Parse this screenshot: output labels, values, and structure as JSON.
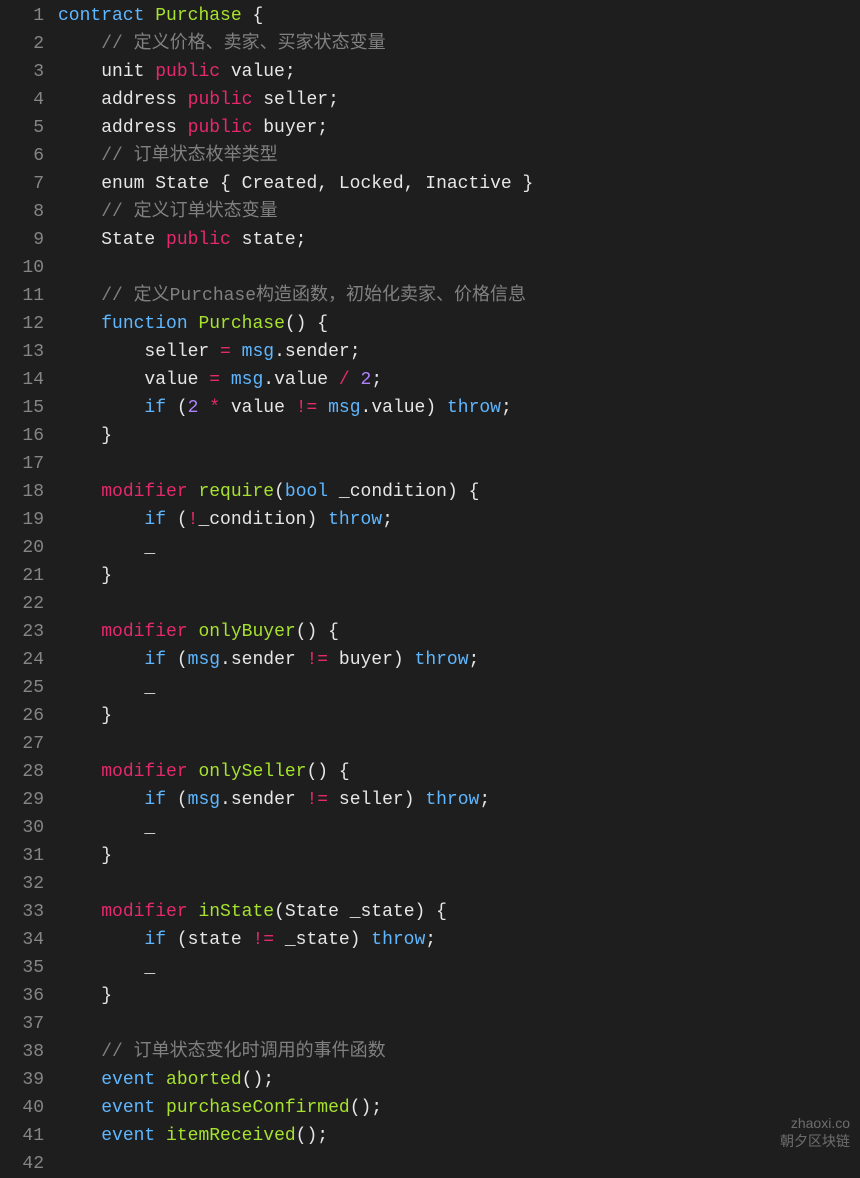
{
  "watermark": {
    "line1": "zhaoxi.co",
    "line2": "朝夕区块链"
  },
  "lines": [
    {
      "n": 1,
      "tokens": [
        [
          "kw",
          "contract"
        ],
        [
          "sp",
          " "
        ],
        [
          "type",
          "Purchase"
        ],
        [
          "sp",
          " "
        ],
        [
          "punc",
          "{"
        ]
      ]
    },
    {
      "n": 2,
      "tokens": [
        [
          "ind",
          "    "
        ],
        [
          "comm",
          "// 定义价格、卖家、买家状态变量"
        ]
      ]
    },
    {
      "n": 3,
      "tokens": [
        [
          "ind",
          "    "
        ],
        [
          "id",
          "unit "
        ],
        [
          "mod",
          "public"
        ],
        [
          "id",
          " value;"
        ]
      ]
    },
    {
      "n": 4,
      "tokens": [
        [
          "ind",
          "    "
        ],
        [
          "id",
          "address "
        ],
        [
          "mod",
          "public"
        ],
        [
          "id",
          " seller;"
        ]
      ]
    },
    {
      "n": 5,
      "tokens": [
        [
          "ind",
          "    "
        ],
        [
          "id",
          "address "
        ],
        [
          "mod",
          "public"
        ],
        [
          "id",
          " buyer;"
        ]
      ]
    },
    {
      "n": 6,
      "tokens": [
        [
          "ind",
          "    "
        ],
        [
          "comm",
          "// 订单状态枚举类型"
        ]
      ]
    },
    {
      "n": 7,
      "tokens": [
        [
          "ind",
          "    "
        ],
        [
          "id",
          "enum State { Created, Locked, Inactive }"
        ]
      ]
    },
    {
      "n": 8,
      "tokens": [
        [
          "ind",
          "    "
        ],
        [
          "comm",
          "// 定义订单状态变量"
        ]
      ]
    },
    {
      "n": 9,
      "tokens": [
        [
          "ind",
          "    "
        ],
        [
          "id",
          "State "
        ],
        [
          "mod",
          "public"
        ],
        [
          "id",
          " state;"
        ]
      ]
    },
    {
      "n": 10,
      "tokens": []
    },
    {
      "n": 11,
      "tokens": [
        [
          "ind",
          "    "
        ],
        [
          "comm",
          "// 定义Purchase构造函数，初始化卖家、价格信息"
        ]
      ]
    },
    {
      "n": 12,
      "tokens": [
        [
          "ind",
          "    "
        ],
        [
          "kw",
          "function"
        ],
        [
          "sp",
          " "
        ],
        [
          "fn",
          "Purchase"
        ],
        [
          "punc",
          "()"
        ],
        [
          "sp",
          " "
        ],
        [
          "punc",
          "{"
        ]
      ]
    },
    {
      "n": 13,
      "tokens": [
        [
          "ind",
          "        "
        ],
        [
          "id",
          "seller "
        ],
        [
          "op",
          "="
        ],
        [
          "id",
          " "
        ],
        [
          "var",
          "msg"
        ],
        [
          "punc",
          "."
        ],
        [
          "id",
          "sender;"
        ]
      ]
    },
    {
      "n": 14,
      "tokens": [
        [
          "ind",
          "        "
        ],
        [
          "id",
          "value "
        ],
        [
          "op",
          "="
        ],
        [
          "id",
          " "
        ],
        [
          "var",
          "msg"
        ],
        [
          "punc",
          "."
        ],
        [
          "id",
          "value "
        ],
        [
          "op",
          "/"
        ],
        [
          "id",
          " "
        ],
        [
          "num",
          "2"
        ],
        [
          "punc",
          ";"
        ]
      ]
    },
    {
      "n": 15,
      "tokens": [
        [
          "ind",
          "        "
        ],
        [
          "kw",
          "if"
        ],
        [
          "punc",
          " ("
        ],
        [
          "num",
          "2"
        ],
        [
          "id",
          " "
        ],
        [
          "op",
          "*"
        ],
        [
          "id",
          " value "
        ],
        [
          "op",
          "!="
        ],
        [
          "id",
          " "
        ],
        [
          "var",
          "msg"
        ],
        [
          "punc",
          "."
        ],
        [
          "id",
          "value) "
        ],
        [
          "kw",
          "throw"
        ],
        [
          "punc",
          ";"
        ]
      ]
    },
    {
      "n": 16,
      "tokens": [
        [
          "ind",
          "    "
        ],
        [
          "punc",
          "}"
        ]
      ]
    },
    {
      "n": 17,
      "tokens": []
    },
    {
      "n": 18,
      "tokens": [
        [
          "ind",
          "    "
        ],
        [
          "mod",
          "modifier"
        ],
        [
          "sp",
          " "
        ],
        [
          "fn",
          "require"
        ],
        [
          "punc",
          "("
        ],
        [
          "bool",
          "bool"
        ],
        [
          "id",
          " _condition"
        ],
        [
          "punc",
          ")"
        ],
        [
          "sp",
          " "
        ],
        [
          "punc",
          "{"
        ]
      ]
    },
    {
      "n": 19,
      "tokens": [
        [
          "ind",
          "        "
        ],
        [
          "kw",
          "if"
        ],
        [
          "punc",
          " ("
        ],
        [
          "op",
          "!"
        ],
        [
          "id",
          "_condition) "
        ],
        [
          "kw",
          "throw"
        ],
        [
          "punc",
          ";"
        ]
      ]
    },
    {
      "n": 20,
      "tokens": [
        [
          "ind",
          "        "
        ],
        [
          "id",
          "_"
        ]
      ]
    },
    {
      "n": 21,
      "tokens": [
        [
          "ind",
          "    "
        ],
        [
          "punc",
          "}"
        ]
      ]
    },
    {
      "n": 22,
      "tokens": []
    },
    {
      "n": 23,
      "tokens": [
        [
          "ind",
          "    "
        ],
        [
          "mod",
          "modifier"
        ],
        [
          "sp",
          " "
        ],
        [
          "fn",
          "onlyBuyer"
        ],
        [
          "punc",
          "()"
        ],
        [
          "sp",
          " "
        ],
        [
          "punc",
          "{"
        ]
      ]
    },
    {
      "n": 24,
      "tokens": [
        [
          "ind",
          "        "
        ],
        [
          "kw",
          "if"
        ],
        [
          "punc",
          " ("
        ],
        [
          "var",
          "msg"
        ],
        [
          "punc",
          "."
        ],
        [
          "id",
          "sender "
        ],
        [
          "op",
          "!="
        ],
        [
          "id",
          " buyer) "
        ],
        [
          "kw",
          "throw"
        ],
        [
          "punc",
          ";"
        ]
      ]
    },
    {
      "n": 25,
      "tokens": [
        [
          "ind",
          "        "
        ],
        [
          "id",
          "_"
        ]
      ]
    },
    {
      "n": 26,
      "tokens": [
        [
          "ind",
          "    "
        ],
        [
          "punc",
          "}"
        ]
      ]
    },
    {
      "n": 27,
      "tokens": []
    },
    {
      "n": 28,
      "tokens": [
        [
          "ind",
          "    "
        ],
        [
          "mod",
          "modifier"
        ],
        [
          "sp",
          " "
        ],
        [
          "fn",
          "onlySeller"
        ],
        [
          "punc",
          "()"
        ],
        [
          "sp",
          " "
        ],
        [
          "punc",
          "{"
        ]
      ]
    },
    {
      "n": 29,
      "tokens": [
        [
          "ind",
          "        "
        ],
        [
          "kw",
          "if"
        ],
        [
          "punc",
          " ("
        ],
        [
          "var",
          "msg"
        ],
        [
          "punc",
          "."
        ],
        [
          "id",
          "sender "
        ],
        [
          "op",
          "!="
        ],
        [
          "id",
          " seller) "
        ],
        [
          "kw",
          "throw"
        ],
        [
          "punc",
          ";"
        ]
      ]
    },
    {
      "n": 30,
      "tokens": [
        [
          "ind",
          "        "
        ],
        [
          "id",
          "_"
        ]
      ]
    },
    {
      "n": 31,
      "tokens": [
        [
          "ind",
          "    "
        ],
        [
          "punc",
          "}"
        ]
      ]
    },
    {
      "n": 32,
      "tokens": []
    },
    {
      "n": 33,
      "tokens": [
        [
          "ind",
          "    "
        ],
        [
          "mod",
          "modifier"
        ],
        [
          "sp",
          " "
        ],
        [
          "fn",
          "inState"
        ],
        [
          "punc",
          "("
        ],
        [
          "id",
          "State _state"
        ],
        [
          "punc",
          ")"
        ],
        [
          "sp",
          " "
        ],
        [
          "punc",
          "{"
        ]
      ]
    },
    {
      "n": 34,
      "tokens": [
        [
          "ind",
          "        "
        ],
        [
          "kw",
          "if"
        ],
        [
          "punc",
          " ("
        ],
        [
          "id",
          "state "
        ],
        [
          "op",
          "!="
        ],
        [
          "id",
          " _state) "
        ],
        [
          "kw",
          "throw"
        ],
        [
          "punc",
          ";"
        ]
      ]
    },
    {
      "n": 35,
      "tokens": [
        [
          "ind",
          "        "
        ],
        [
          "id",
          "_"
        ]
      ]
    },
    {
      "n": 36,
      "tokens": [
        [
          "ind",
          "    "
        ],
        [
          "punc",
          "}"
        ]
      ]
    },
    {
      "n": 37,
      "tokens": []
    },
    {
      "n": 38,
      "tokens": [
        [
          "ind",
          "    "
        ],
        [
          "comm",
          "// 订单状态变化时调用的事件函数"
        ]
      ]
    },
    {
      "n": 39,
      "tokens": [
        [
          "ind",
          "    "
        ],
        [
          "kw",
          "event"
        ],
        [
          "sp",
          " "
        ],
        [
          "fn",
          "aborted"
        ],
        [
          "punc",
          "();"
        ]
      ]
    },
    {
      "n": 40,
      "tokens": [
        [
          "ind",
          "    "
        ],
        [
          "kw",
          "event"
        ],
        [
          "sp",
          " "
        ],
        [
          "fn",
          "purchaseConfirmed"
        ],
        [
          "punc",
          "();"
        ]
      ]
    },
    {
      "n": 41,
      "tokens": [
        [
          "ind",
          "    "
        ],
        [
          "kw",
          "event"
        ],
        [
          "sp",
          " "
        ],
        [
          "fn",
          "itemReceived"
        ],
        [
          "punc",
          "();"
        ]
      ]
    },
    {
      "n": 42,
      "tokens": []
    }
  ]
}
